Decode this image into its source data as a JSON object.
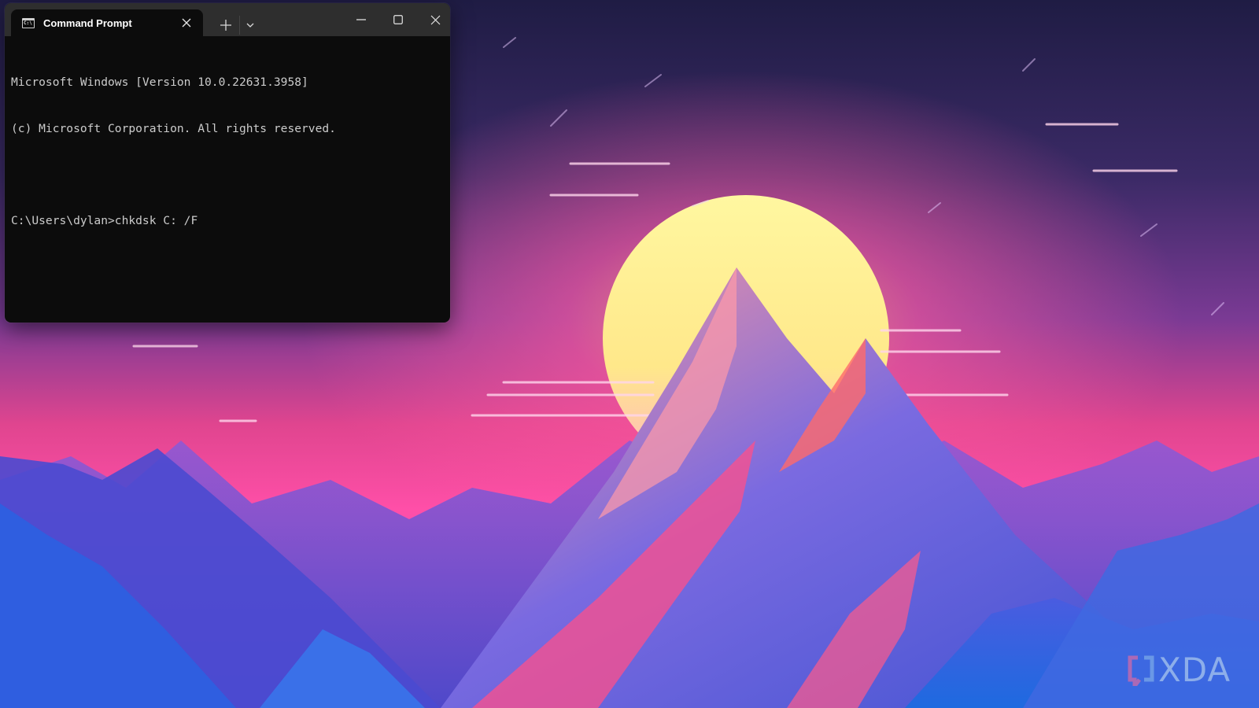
{
  "wallpaper": {
    "description": "Synthwave mountain landscape with yellow sun",
    "colors": {
      "sky_top": "#2a2350",
      "sky_mid": "#6a3a8e",
      "sky_glow": "#ff4a9a",
      "sun": "#fff38a",
      "mountain_blue": "#3b5bd6",
      "mountain_pink": "#ff4f8a",
      "mountain_light": "#6aa0ff"
    }
  },
  "window": {
    "tab": {
      "icon": "cmd-icon",
      "icon_glyph": "C:\\",
      "title": "Command Prompt",
      "close_glyph": "✕"
    },
    "new_tab_glyph": "+",
    "dropdown_icon": "chevron-down-icon",
    "controls": {
      "minimize": "minimize-icon",
      "maximize": "maximize-icon",
      "close": "close-icon"
    },
    "colors": {
      "titlebar": "#2e2e2e",
      "terminal_bg": "#0c0c0c",
      "text": "#cccccc"
    }
  },
  "terminal": {
    "lines": [
      "Microsoft Windows [Version 10.0.22631.3958]",
      "(c) Microsoft Corporation. All rights reserved.",
      "",
      "C:\\Users\\dylan>chkdsk C: /F"
    ]
  },
  "watermark": {
    "text": "XDA"
  }
}
